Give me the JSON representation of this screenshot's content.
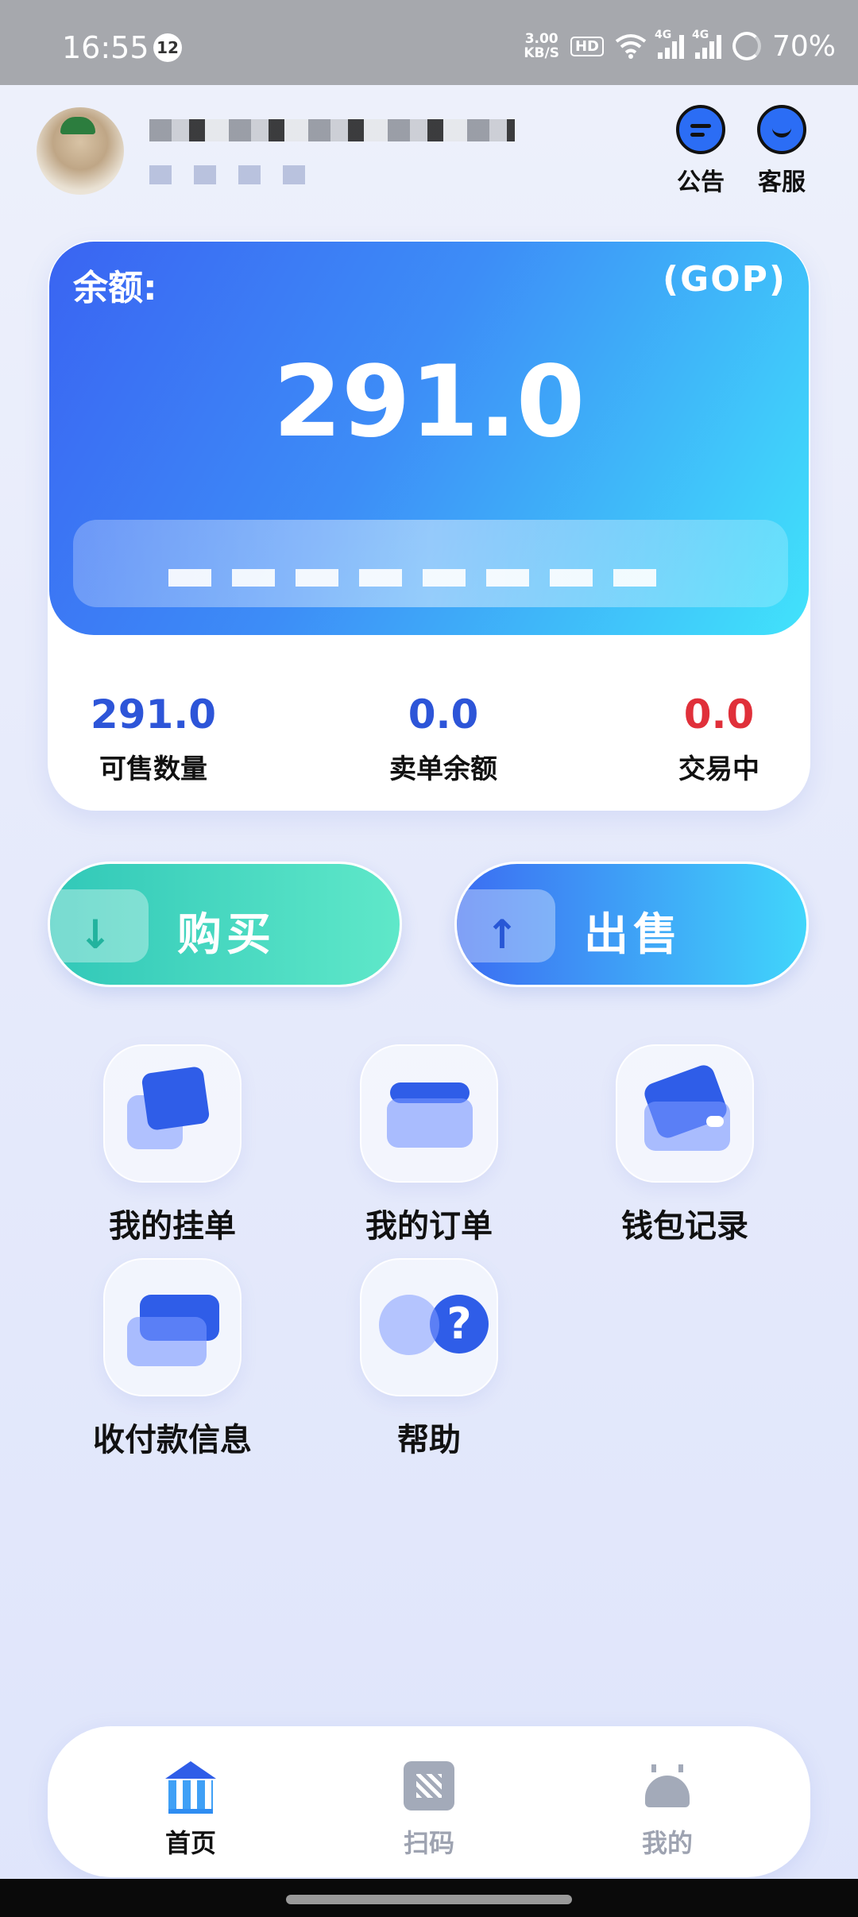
{
  "status_bar": {
    "time": "16:55",
    "notification_count": "12",
    "net_speed": "3.00",
    "net_speed_unit": "KB/S",
    "hd": "HD",
    "signal_1": "4G",
    "signal_2": "4G",
    "battery": "70%"
  },
  "header": {
    "notice_label": "公告",
    "service_label": "客服"
  },
  "balance_card": {
    "title": "余额:",
    "unit": "(GOP)",
    "amount": "291.0"
  },
  "stats": [
    {
      "value": "291.0",
      "label": "可售数量",
      "color": "#2d55d8"
    },
    {
      "value": "0.0",
      "label": "卖单余额",
      "color": "#2d55d8"
    },
    {
      "value": "0.0",
      "label": "交易中",
      "color": "#e0303a"
    }
  ],
  "actions": {
    "buy_label": "购买",
    "sell_label": "出售",
    "buy_arrow": "↓",
    "sell_arrow": "↑"
  },
  "menu": [
    {
      "label": "我的挂单",
      "icon": "pending-orders-icon"
    },
    {
      "label": "我的订单",
      "icon": "folder-orders-icon"
    },
    {
      "label": "钱包记录",
      "icon": "wallet-icon"
    },
    {
      "label": "收付款信息",
      "icon": "payment-card-icon"
    },
    {
      "label": "帮助",
      "icon": "help-icon",
      "glyph": "?"
    }
  ],
  "bottom_nav": [
    {
      "label": "首页",
      "icon": "bank-icon",
      "active": true
    },
    {
      "label": "扫码",
      "icon": "qr-code-icon",
      "active": false
    },
    {
      "label": "我的",
      "icon": "profile-icon",
      "active": false
    }
  ],
  "colors": {
    "primary_blue": "#2f5de8",
    "buy_green": "#31c8b8",
    "alert_red": "#e0303a"
  }
}
